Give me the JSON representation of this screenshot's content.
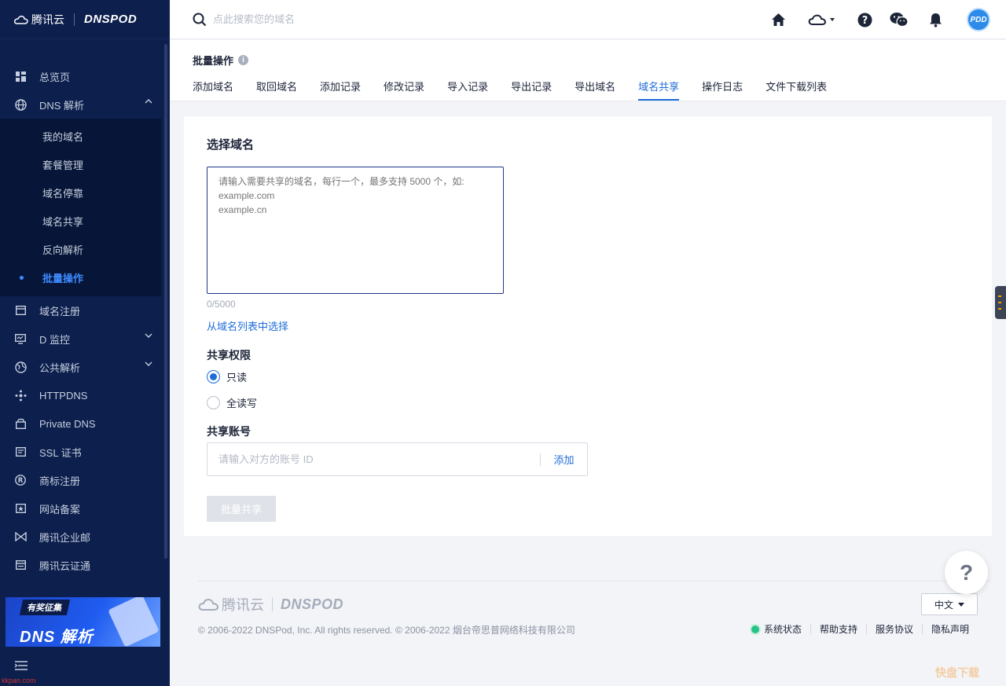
{
  "sidebar": {
    "brand_tencent": "腾讯云",
    "brand_dnspod": "DNSPOD",
    "items": [
      {
        "label": "总览页",
        "icon": "dashboard-icon"
      },
      {
        "label": "DNS 解析",
        "icon": "globe-icon",
        "expanded": true
      },
      {
        "label": "域名注册",
        "icon": "domain-register-icon"
      },
      {
        "label": "D 监控",
        "icon": "monitor-icon"
      },
      {
        "label": "公共解析",
        "icon": "public-dns-icon"
      },
      {
        "label": "HTTPDNS",
        "icon": "httpdns-icon"
      },
      {
        "label": "Private DNS",
        "icon": "lock-icon"
      },
      {
        "label": "SSL 证书",
        "icon": "certificate-icon"
      },
      {
        "label": "商标注册",
        "icon": "trademark-icon"
      },
      {
        "label": "网站备案",
        "icon": "icp-icon"
      },
      {
        "label": "腾讯企业邮",
        "icon": "mail-icon"
      },
      {
        "label": "腾讯云证通",
        "icon": "id-card-icon"
      }
    ],
    "sub_items": [
      {
        "label": "我的域名"
      },
      {
        "label": "套餐管理"
      },
      {
        "label": "域名停靠"
      },
      {
        "label": "域名共享"
      },
      {
        "label": "反向解析"
      },
      {
        "label": "批量操作",
        "active": true
      }
    ],
    "banner": {
      "tag": "有奖征集",
      "title": "DNS 解析"
    }
  },
  "header": {
    "search_placeholder": "点此搜索您的域名",
    "icons": [
      "home-icon",
      "cloud-icon",
      "help-icon",
      "wechat-icon",
      "bell-icon"
    ],
    "avatar_text": "PDD"
  },
  "page": {
    "title": "批量操作",
    "tabs": [
      {
        "label": "添加域名"
      },
      {
        "label": "取回域名"
      },
      {
        "label": "添加记录"
      },
      {
        "label": "修改记录"
      },
      {
        "label": "导入记录"
      },
      {
        "label": "导出记录"
      },
      {
        "label": "导出域名"
      },
      {
        "label": "域名共享",
        "active": true
      },
      {
        "label": "操作日志"
      },
      {
        "label": "文件下载列表"
      }
    ]
  },
  "form": {
    "section_title": "选择域名",
    "textarea_placeholder": "请输入需要共享的域名，每行一个，最多支持 5000 个，如:\nexample.com\nexample.cn",
    "counter": "0/5000",
    "select_link": "从域名列表中选择",
    "perm_label": "共享权限",
    "perm_options": [
      {
        "label": "只读",
        "checked": true
      },
      {
        "label": "全读写",
        "checked": false
      }
    ],
    "account_label": "共享账号",
    "account_placeholder": "请输入对方的账号 ID",
    "add_label": "添加",
    "submit_label": "批量共享"
  },
  "footer": {
    "logo_tencent": "腾讯云",
    "logo_dnspod": "DNSPOD",
    "copyright": "© 2006-2022 DNSPod, Inc. All rights reserved. © 2006-2022 烟台帝思普网络科技有限公司",
    "language": "中文",
    "links": [
      "系统状态",
      "帮助支持",
      "服务协议",
      "隐私声明"
    ]
  },
  "float_help": "?",
  "watermark_left": "kkpan.com",
  "watermark_right": "快盘下载"
}
